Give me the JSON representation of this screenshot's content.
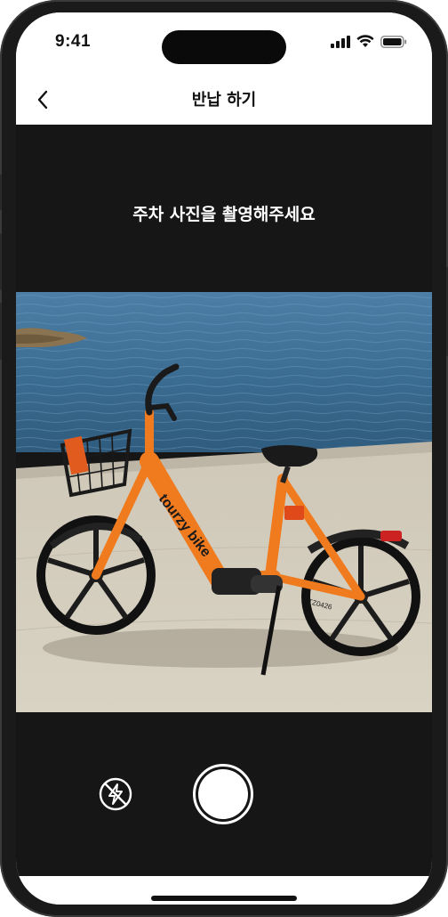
{
  "status_bar": {
    "time": "9:41"
  },
  "nav": {
    "title": "반납 하기",
    "back_icon": "chevron-left-icon"
  },
  "camera": {
    "instruction": "주차 사진을 촬영해주세요",
    "photo": {
      "bike_brand": "tourzy bike",
      "bike_id": "TZ0426"
    },
    "controls": {
      "flash_icon": "flash-off-icon",
      "shutter_icon": "shutter-button"
    }
  },
  "colors": {
    "camera_bg": "#161616",
    "bike_orange": "#f07a1e",
    "sea": "#3b6f94",
    "pavement": "#d2ccbe"
  }
}
